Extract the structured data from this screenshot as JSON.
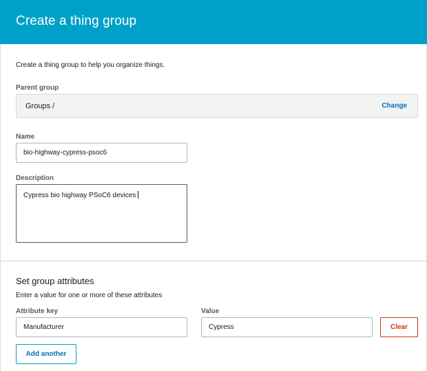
{
  "header": {
    "title": "Create a thing group"
  },
  "intro": "Create a thing group to help you organize things.",
  "parent_group": {
    "label": "Parent group",
    "value": "Groups /",
    "change_label": "Change"
  },
  "name": {
    "label": "Name",
    "value": "bio-highway-cypress-psoc6"
  },
  "description": {
    "label": "Description",
    "value": "Cypress bio highway PSoC6 devices"
  },
  "attributes": {
    "title": "Set group attributes",
    "subtitle": "Enter a value for one or more of these attributes",
    "key_label": "Attribute key",
    "value_label": "Value",
    "rows": [
      {
        "key": "Manufacturer",
        "value": "Cypress"
      }
    ],
    "clear_label": "Clear",
    "add_label": "Add another"
  },
  "colors": {
    "header": "#00a1c9",
    "link": "#0073bb",
    "danger": "#d13212"
  }
}
